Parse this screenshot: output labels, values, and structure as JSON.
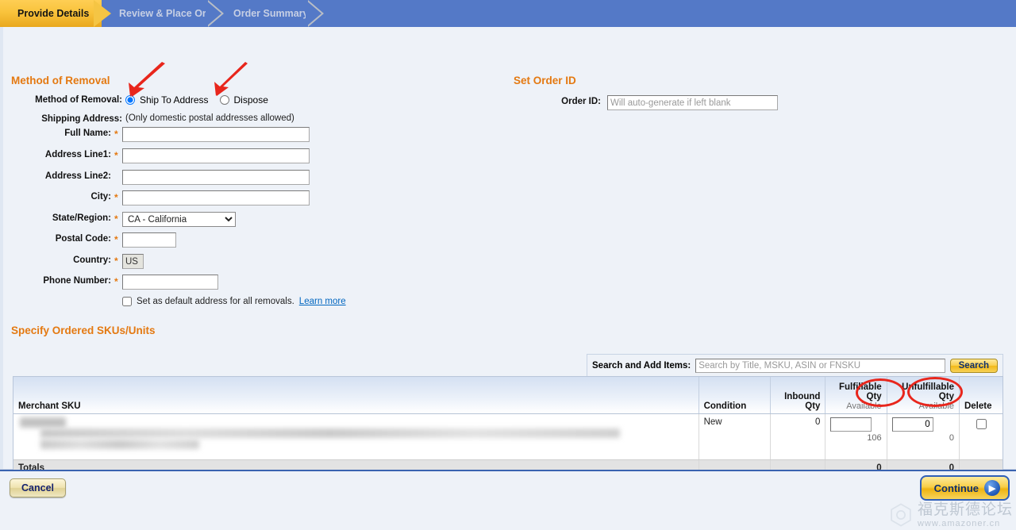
{
  "wizard": {
    "tabs": [
      {
        "label": "Provide Details",
        "state": "active"
      },
      {
        "label": "Review & Place Order",
        "state": "inactive"
      },
      {
        "label": "Order Summary",
        "state": "inactive"
      }
    ]
  },
  "method_section": {
    "title": "Method of Removal",
    "method_label": "Method of Removal:",
    "options": [
      {
        "label": "Ship To Address",
        "selected": true
      },
      {
        "label": "Dispose",
        "selected": false
      }
    ],
    "shipping_address_label": "Shipping Address:",
    "shipping_note": "(Only domestic postal addresses allowed)",
    "fields": [
      {
        "label": "Full Name:",
        "required": true,
        "value": "",
        "type": "text"
      },
      {
        "label": "Address Line1:",
        "required": true,
        "value": "",
        "type": "text"
      },
      {
        "label": "Address Line2:",
        "required": false,
        "value": "",
        "type": "text"
      },
      {
        "label": "City:",
        "required": true,
        "value": "",
        "type": "text"
      },
      {
        "label": "State/Region:",
        "required": true,
        "value": "CA - California",
        "type": "select"
      },
      {
        "label": "Postal Code:",
        "required": true,
        "value": "",
        "type": "text"
      },
      {
        "label": "Country:",
        "required": true,
        "value": "US",
        "type": "readonly"
      },
      {
        "label": "Phone Number:",
        "required": true,
        "value": "",
        "type": "text"
      }
    ],
    "state_selected": "CA - California",
    "country_value": "US",
    "default_checkbox_label": "Set as default address for all removals.",
    "default_checked": false,
    "learn_more": "Learn more"
  },
  "order_id_section": {
    "title": "Set Order ID",
    "label": "Order ID:",
    "value": "",
    "placeholder": "Will auto-generate if left blank"
  },
  "sku_section": {
    "title": "Specify Ordered SKUs/Units",
    "search_label": "Search and Add Items:",
    "search_value": "",
    "search_placeholder": "Search by Title, MSKU, ASIN or FNSKU",
    "search_button": "Search",
    "columns": [
      {
        "label": "Merchant SKU",
        "sub": ""
      },
      {
        "label": "Condition",
        "sub": ""
      },
      {
        "label": "Inbound Qty",
        "sub": ""
      },
      {
        "label": "Fulfillable Qty",
        "sub": "Available"
      },
      {
        "label": "Unfulfillable Qty",
        "sub": "Available"
      },
      {
        "label": "Delete",
        "sub": ""
      }
    ],
    "rows": [
      {
        "merchant_sku": "",
        "condition": "New",
        "inbound_qty": "0",
        "fulfillable_qty_value": "",
        "fulfillable_available": "106",
        "unfulfillable_qty_value": "0",
        "unfulfillable_available": "0",
        "delete_checked": false
      }
    ],
    "totals_label": "Totals",
    "totals_fulfillable": "0",
    "totals_unfulfillable": "0"
  },
  "footer": {
    "cancel": "Cancel",
    "continue": "Continue",
    "continue_icon": "arrow-right-circle-icon"
  },
  "watermark": {
    "text_cn": "福克斯德论坛",
    "url": "www.amazoner.cn"
  },
  "colors": {
    "accent_orange": "#e47911",
    "wizard_blue": "#5479c7",
    "active_tab_gold": "#f5c544",
    "page_bg": "#eef2f8",
    "annotation_red": "#e8261c"
  }
}
